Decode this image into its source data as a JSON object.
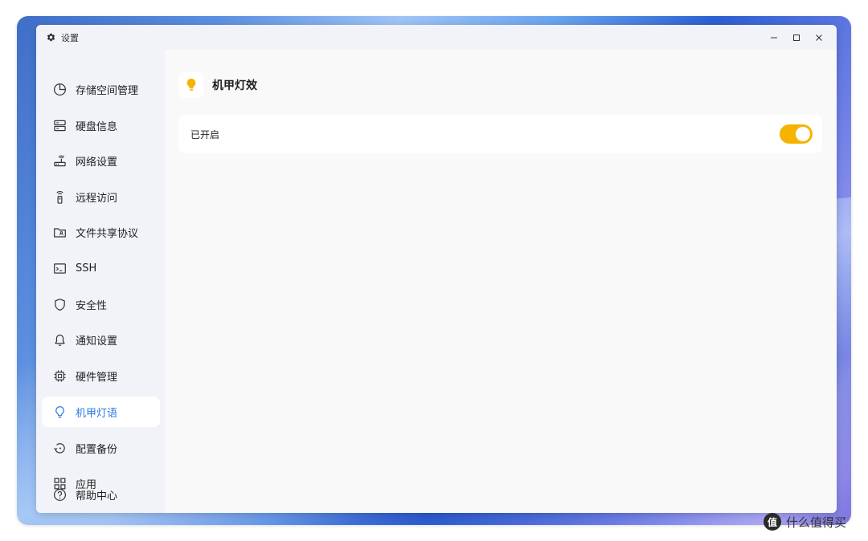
{
  "window": {
    "title": "设置",
    "controls": [
      "minimize",
      "maximize",
      "close"
    ]
  },
  "sidebar": {
    "items": [
      {
        "label": "存储空间管理",
        "icon": "pie-chart-icon",
        "active": false
      },
      {
        "label": "硬盘信息",
        "icon": "server-icon",
        "active": false
      },
      {
        "label": "网络设置",
        "icon": "router-icon",
        "active": false
      },
      {
        "label": "远程访问",
        "icon": "remote-icon",
        "active": false
      },
      {
        "label": "文件共享协议",
        "icon": "shared-folder-icon",
        "active": false
      },
      {
        "label": "SSH",
        "icon": "terminal-icon",
        "active": false
      },
      {
        "label": "安全性",
        "icon": "shield-icon",
        "active": false
      },
      {
        "label": "通知设置",
        "icon": "bell-icon",
        "active": false
      },
      {
        "label": "硬件管理",
        "icon": "chip-icon",
        "active": false
      },
      {
        "label": "机甲灯语",
        "icon": "lightbulb-icon",
        "active": true
      },
      {
        "label": "配置备份",
        "icon": "backup-icon",
        "active": false
      },
      {
        "label": "应用",
        "icon": "apps-grid-icon",
        "active": false
      },
      {
        "label": "帮助中心",
        "icon": "help-icon",
        "active": false
      }
    ]
  },
  "main": {
    "header": {
      "icon": "lightbulb-icon",
      "title": "机甲灯效"
    },
    "setting": {
      "label": "已开启",
      "enabled": true
    }
  },
  "watermark": {
    "logo": "值",
    "text": "什么值得买"
  },
  "colors": {
    "accent": "#2b7be4",
    "toggle_on": "#f6b300",
    "bulb": "#f6b300",
    "sidebar_bg": "#f1f3f8",
    "content_bg": "#f9f9fa"
  }
}
